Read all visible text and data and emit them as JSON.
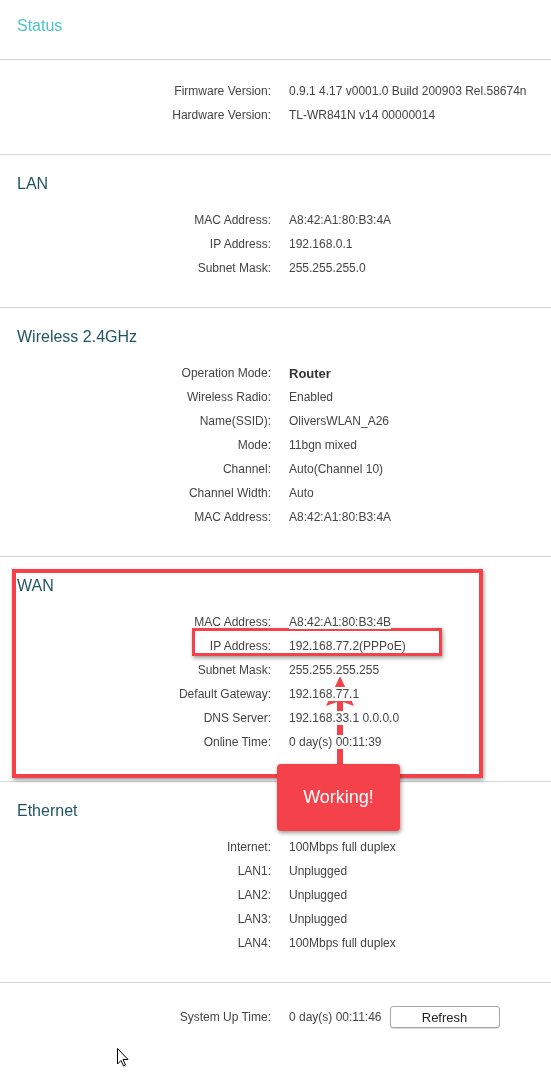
{
  "page_title": "Status",
  "sections": [
    {
      "annotated": false,
      "rows": [
        {
          "label": "Firmware Version:",
          "value": "0.9.1 4.17 v0001.0 Build 200903 Rel.58674n",
          "bold": false,
          "highlighted": false
        },
        {
          "label": "Hardware Version:",
          "value": "TL-WR841N v14 00000014",
          "bold": false,
          "highlighted": false
        }
      ]
    },
    {
      "title": "LAN",
      "annotated": false,
      "rows": [
        {
          "label": "MAC Address:",
          "value": "A8:42:A1:80:B3:4A",
          "bold": false,
          "highlighted": false
        },
        {
          "label": "IP Address:",
          "value": "192.168.0.1",
          "bold": false,
          "highlighted": false
        },
        {
          "label": "Subnet Mask:",
          "value": "255.255.255.0",
          "bold": false,
          "highlighted": false
        }
      ]
    },
    {
      "title": "Wireless 2.4GHz",
      "annotated": false,
      "rows": [
        {
          "label": "Operation Mode:",
          "value": "Router",
          "bold": true,
          "highlighted": false
        },
        {
          "label": "Wireless Radio:",
          "value": "Enabled",
          "bold": false,
          "highlighted": false
        },
        {
          "label": "Name(SSID):",
          "value": "OliversWLAN_A26",
          "bold": false,
          "highlighted": false
        },
        {
          "label": "Mode:",
          "value": "11bgn mixed",
          "bold": false,
          "highlighted": false
        },
        {
          "label": "Channel:",
          "value": "Auto(Channel 10)",
          "bold": false,
          "highlighted": false
        },
        {
          "label": "Channel Width:",
          "value": "Auto",
          "bold": false,
          "highlighted": false
        },
        {
          "label": "MAC Address:",
          "value": "A8:42:A1:80:B3:4A",
          "bold": false,
          "highlighted": false
        }
      ]
    },
    {
      "title": "WAN",
      "annotated": true,
      "rows": [
        {
          "label": "MAC Address:",
          "value": "A8:42:A1:80:B3:4B",
          "bold": false,
          "highlighted": false
        },
        {
          "label": "IP Address:",
          "value": "192.168.77.2(PPPoE)",
          "bold": false,
          "highlighted": true
        },
        {
          "label": "Subnet Mask:",
          "value": "255.255.255.255",
          "bold": false,
          "highlighted": false
        },
        {
          "label": "Default Gateway:",
          "value": "192.168.77.1",
          "bold": false,
          "highlighted": false
        },
        {
          "label": "DNS Server:",
          "value": "192.168.33.1 0.0.0.0",
          "bold": false,
          "highlighted": false
        },
        {
          "label": "Online Time:",
          "value": "0 day(s) 00:11:39",
          "bold": false,
          "highlighted": false
        }
      ]
    },
    {
      "title": "Ethernet",
      "annotated": false,
      "rows": [
        {
          "label": "Internet:",
          "value": "100Mbps full duplex",
          "bold": false,
          "highlighted": false
        },
        {
          "label": "LAN1:",
          "value": "Unplugged",
          "bold": false,
          "highlighted": false
        },
        {
          "label": "LAN2:",
          "value": "Unplugged",
          "bold": false,
          "highlighted": false
        },
        {
          "label": "LAN3:",
          "value": "Unplugged",
          "bold": false,
          "highlighted": false
        },
        {
          "label": "LAN4:",
          "value": "100Mbps full duplex",
          "bold": false,
          "highlighted": false
        }
      ]
    }
  ],
  "system": {
    "label": "System Up Time:",
    "value": "0 day(s) 00:11:46",
    "button": "Refresh"
  },
  "callout": "Working!"
}
